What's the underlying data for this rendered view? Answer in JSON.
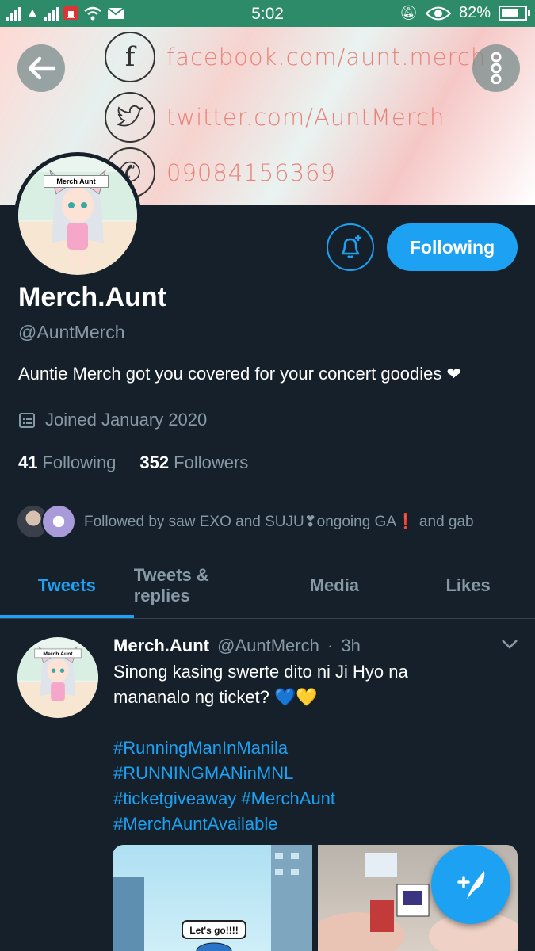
{
  "status_bar": {
    "time": "5:02",
    "battery": "82%",
    "battery_level": 0.82
  },
  "banner": {
    "facebook": "facebook.com/aunt.merch",
    "twitter": "twitter.com/AuntMerch",
    "phone": "09084156369"
  },
  "profile": {
    "avatar_label": "Merch Aunt",
    "name": "Merch.Aunt",
    "handle": "@AuntMerch",
    "bio": "Auntie Merch got you covered for your concert goodies ❤",
    "joined": "Joined January 2020",
    "following_count": "41",
    "following_label": "Following",
    "followers_count": "352",
    "followers_label": "Followers",
    "followed_by": "Followed by saw EXO and SUJU❣ongoing GA❗ and gab",
    "follow_button": "Following"
  },
  "tabs": [
    {
      "label": "Tweets",
      "active": true
    },
    {
      "label": "Tweets & replies",
      "active": false
    },
    {
      "label": "Media",
      "active": false
    },
    {
      "label": "Likes",
      "active": false
    }
  ],
  "tweet": {
    "name": "Merch.Aunt",
    "handle": "@AuntMerch",
    "time": "3h",
    "avatar_label": "Merch Aunt",
    "text": "Sinong kasing swerte dito ni Ji Hyo na mananalo ng ticket? 💙💛",
    "hashtags": [
      "#RunningManInManila",
      "#RUNNINGMANinMNL",
      "#ticketgiveaway #MerchAunt",
      "#MerchAuntAvailable"
    ],
    "media_caption": "Let's go!!!!"
  },
  "colors": {
    "accent": "#1da1f2",
    "background": "#15202b",
    "muted": "#8899a6",
    "status_bar": "#2e8b6a"
  }
}
